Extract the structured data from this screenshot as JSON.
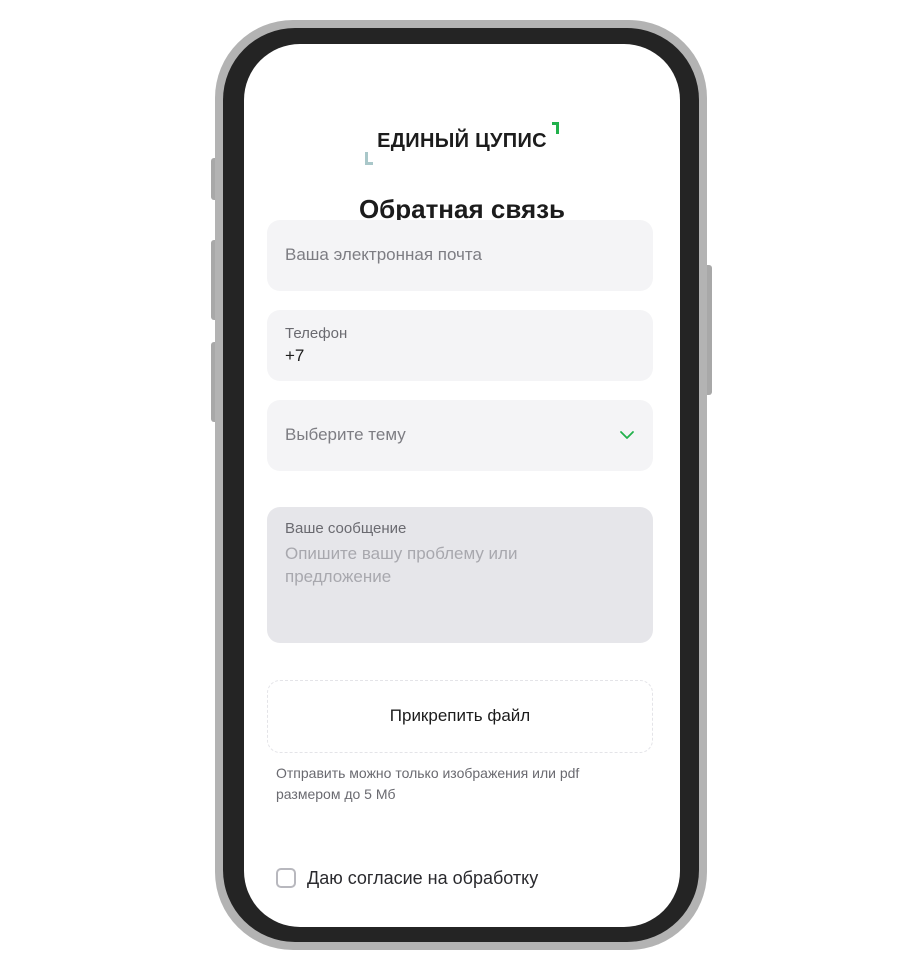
{
  "app": {
    "logo_text": "ЕДИНЫЙ ЦУПИС",
    "title": "Обратная связь"
  },
  "form": {
    "email": {
      "placeholder": "Ваша электронная почта"
    },
    "phone": {
      "label": "Телефон",
      "value": "+7"
    },
    "topic": {
      "placeholder": "Выберите тему",
      "icon": "chevron-down-icon"
    },
    "message": {
      "label": "Ваше сообщение",
      "placeholder": "Опишите вашу проблему или предложение"
    },
    "attach": {
      "label": "Прикрепить файл",
      "hint": "Отправить можно только изображения или pdf размером до 5 Мб"
    },
    "consent": {
      "label": "Даю согласие на обработку",
      "checked": false
    }
  },
  "colors": {
    "accent": "#22b14c",
    "field_bg": "#f4f4f6",
    "message_bg": "#e6e6ea",
    "text": "#1c1c1c",
    "placeholder": "#7d7d83"
  }
}
